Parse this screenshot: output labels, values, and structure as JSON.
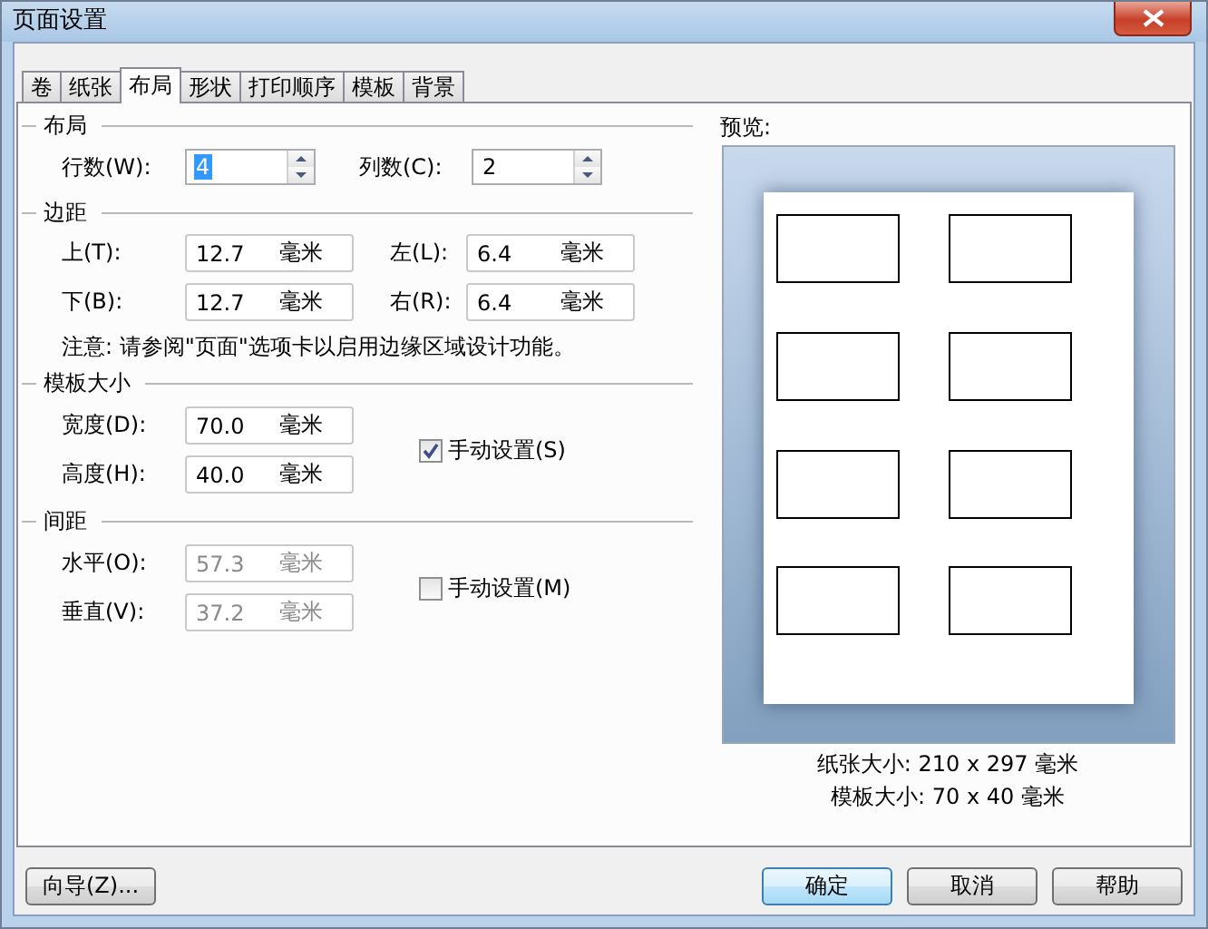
{
  "window": {
    "title": "页面设置"
  },
  "tabs": [
    {
      "label": "卷",
      "selected": false
    },
    {
      "label": "纸张",
      "selected": false
    },
    {
      "label": "布局",
      "selected": true
    },
    {
      "label": "形状",
      "selected": false
    },
    {
      "label": "打印顺序",
      "selected": false
    },
    {
      "label": "模板",
      "selected": false
    },
    {
      "label": "背景",
      "selected": false
    }
  ],
  "layout": {
    "title": "布局",
    "rows": {
      "label": "行数(W):",
      "value": "4",
      "highlighted": true
    },
    "columns": {
      "label": "列数(C):",
      "value": "2",
      "highlighted": false
    }
  },
  "margins": {
    "title": "边距",
    "fields": [
      {
        "label": "上(T):",
        "value": "12.7",
        "unit": "毫米"
      },
      {
        "label": "左(L):",
        "value": "6.4",
        "unit": "毫米"
      },
      {
        "label": "下(B):",
        "value": "12.7",
        "unit": "毫米"
      },
      {
        "label": "右(R):",
        "value": "6.4",
        "unit": "毫米"
      }
    ],
    "note": "注意: 请参阅\"页面\"选项卡以启用边缘区域设计功能。"
  },
  "template_size": {
    "title": "模板大小",
    "fields": [
      {
        "label": "宽度(D):",
        "value": "70.0",
        "unit": "毫米",
        "disabled": false
      },
      {
        "label": "高度(H):",
        "value": "40.0",
        "unit": "毫米",
        "disabled": false
      }
    ],
    "manual": {
      "label": "手动设置(S)",
      "checked": true
    }
  },
  "spacing": {
    "title": "间距",
    "fields": [
      {
        "label": "水平(O):",
        "value": "57.3",
        "unit": "毫米",
        "disabled": true
      },
      {
        "label": "垂直(V):",
        "value": "37.2",
        "unit": "毫米",
        "disabled": true
      }
    ],
    "manual": {
      "label": "手动设置(M)",
      "checked": false
    }
  },
  "preview": {
    "title": "预览:",
    "paper_size": "纸张大小: 210 x 297 毫米",
    "template_size": "模板大小: 70 x 40 毫米"
  },
  "buttons": {
    "wizard": "向导(Z)...",
    "ok": "确定",
    "cancel": "取消",
    "help": "帮助"
  }
}
